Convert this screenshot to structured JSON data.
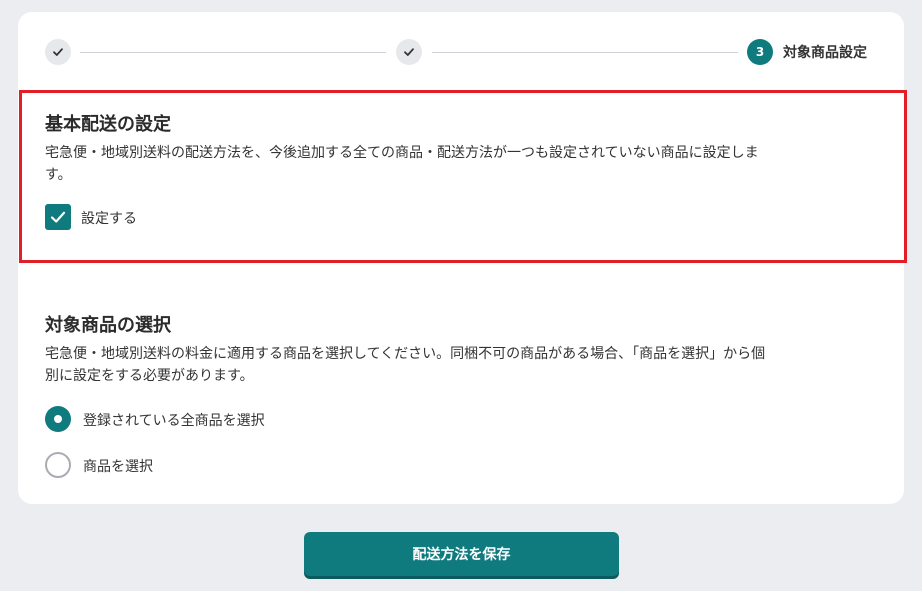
{
  "stepper": {
    "step3_number": "3",
    "step3_label": "対象商品設定"
  },
  "basic_shipping": {
    "title": "基本配送の設定",
    "desc_line1": "宅急便・地域別送料の配送方法を、今後追加する全ての商品・配送方法が一つも設定されていない商品に設定しま",
    "desc_line2": "す。",
    "checkbox_label": "設定する",
    "checked": true
  },
  "target_products": {
    "title": "対象商品の選択",
    "desc_line1": "宅急便・地域別送料の料金に適用する商品を選択してください。同梱不可の商品がある場合、「商品を選択」から個",
    "desc_line2": "別に設定をする必要があります。",
    "options": [
      {
        "label": "登録されている全商品を選択",
        "selected": true
      },
      {
        "label": "商品を選択",
        "selected": false
      }
    ]
  },
  "footer": {
    "save_label": "配送方法を保存"
  },
  "colors": {
    "accent": "#0f7b7f",
    "highlight_border": "#e21e26",
    "background": "#ebedf0"
  }
}
